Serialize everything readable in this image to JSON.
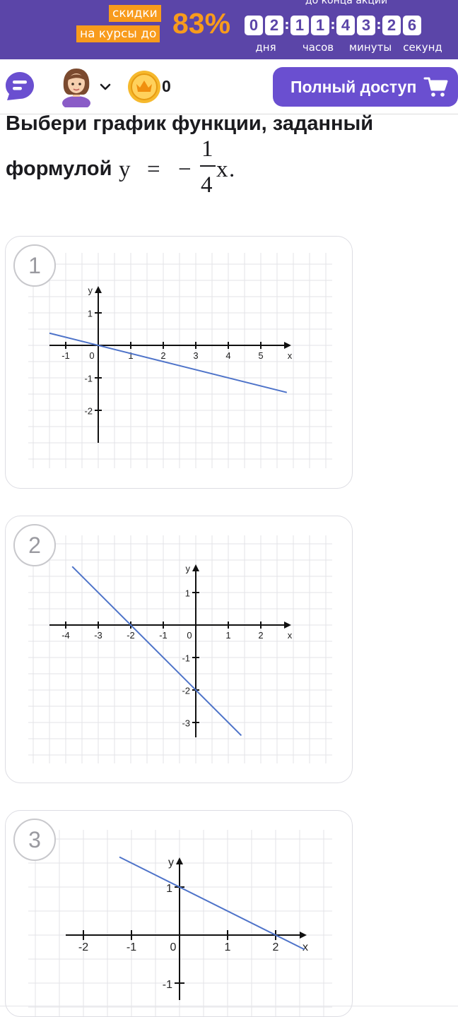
{
  "promo": {
    "tag_line1": "скидки",
    "tag_line2": "на курсы до",
    "percent": "83%",
    "caption": "до конца акции",
    "timer": {
      "days": [
        "0",
        "2"
      ],
      "hours": [
        "1",
        "1"
      ],
      "minutes": [
        "4",
        "3"
      ],
      "seconds": [
        "2",
        "6"
      ],
      "separator": ":",
      "units": [
        "дня",
        "часов",
        "минуты",
        "секунд"
      ]
    },
    "colors": {
      "background": "#5b45a8",
      "accent": "#f89b1c"
    }
  },
  "topbar": {
    "chat_icon": "chat-bubble-icon",
    "avatar_icon": "user-avatar-icon",
    "coin_icon": "crown-coin-icon",
    "coin_count": "0",
    "full_access_label": "Полный доступ",
    "cart_icon": "cart-icon",
    "button_color": "#6a4fd0"
  },
  "question": {
    "text": "Выбери график функции, заданный",
    "formula_prefix": "формулой",
    "formula": {
      "lhs": "y",
      "equals": "=",
      "sign": "−",
      "numerator": "1",
      "denominator": "4",
      "variable": "x",
      "end": "."
    }
  },
  "options": [
    {
      "number": "1",
      "xlabel": "x",
      "ylabel": "y",
      "x_ticks": [
        "-1",
        "1",
        "2",
        "3",
        "4",
        "5"
      ],
      "y_ticks": [
        "1",
        "-1",
        "-2"
      ],
      "origin_label": "0",
      "line": {
        "x": [
          -1.5,
          5.8
        ],
        "y": [
          0.375,
          -1.45
        ]
      }
    },
    {
      "number": "2",
      "xlabel": "x",
      "ylabel": "y",
      "x_ticks": [
        "-4",
        "-3",
        "-2",
        "-1",
        "1",
        "2"
      ],
      "y_ticks": [
        "1",
        "-1",
        "-2",
        "-3"
      ],
      "origin_label": "0",
      "line": {
        "x": [
          -3.8,
          1.4
        ],
        "y": [
          1.8,
          -3.4
        ]
      }
    },
    {
      "number": "3",
      "xlabel": "x",
      "ylabel": "y",
      "x_ticks": [
        "-2",
        "-1",
        "1",
        "2"
      ],
      "y_ticks": [
        "1",
        "-1"
      ],
      "origin_label": "0",
      "line": {
        "x": [
          -1.25,
          2.6
        ],
        "y": [
          1.625,
          -0.3
        ]
      }
    }
  ],
  "chart_data": [
    {
      "type": "line",
      "series": [
        {
          "x": [
            -1.5,
            5.8
          ],
          "y": [
            0.375,
            -1.45
          ]
        }
      ],
      "xlabel": "x",
      "ylabel": "y",
      "xlim": [
        -1.5,
        5.8
      ],
      "ylim": [
        -3,
        1.8
      ],
      "grid": true
    },
    {
      "type": "line",
      "series": [
        {
          "x": [
            -3.8,
            1.4
          ],
          "y": [
            1.8,
            -3.4
          ]
        }
      ],
      "xlabel": "x",
      "ylabel": "y",
      "xlim": [
        -4.5,
        2.9
      ],
      "ylim": [
        -3.5,
        1.9
      ],
      "grid": true
    },
    {
      "type": "line",
      "series": [
        {
          "x": [
            -1.25,
            2.6
          ],
          "y": [
            1.625,
            -0.3
          ]
        }
      ],
      "xlabel": "x",
      "ylabel": "y",
      "xlim": [
        -2.4,
        2.6
      ],
      "ylim": [
        -1.4,
        1.6
      ],
      "grid": true
    }
  ]
}
